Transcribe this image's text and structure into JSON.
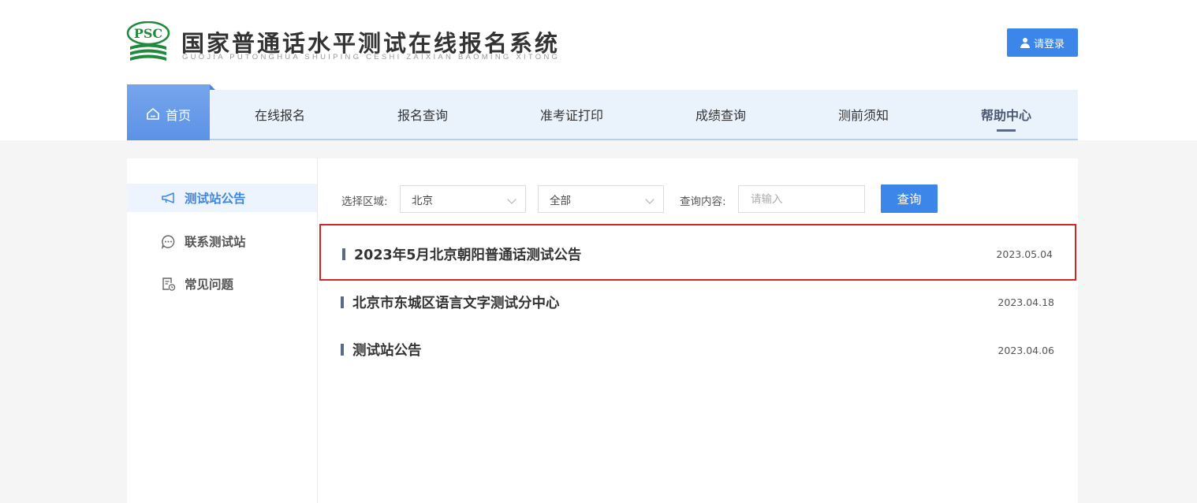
{
  "header": {
    "logo_text": "PSC",
    "title": "国家普通话水平测试在线报名系统",
    "subtitle": "GUOJIA PUTONGHUA SHUIPING CESHI ZAIXIAN BAOMING XITONG",
    "login_label": "请登录",
    "brand_green": "#1f8a3c"
  },
  "nav": {
    "items": [
      {
        "label": "首页"
      },
      {
        "label": "在线报名"
      },
      {
        "label": "报名查询"
      },
      {
        "label": "准考证打印"
      },
      {
        "label": "成绩查询"
      },
      {
        "label": "测前须知"
      },
      {
        "label": "帮助中心"
      }
    ],
    "active": "帮助中心"
  },
  "sidebar": {
    "items": [
      {
        "label": "测试站公告",
        "icon": "megaphone-icon",
        "active": true
      },
      {
        "label": "联系测试站",
        "icon": "chat-bubble-icon",
        "active": false
      },
      {
        "label": "常见问题",
        "icon": "document-clock-icon",
        "active": false
      }
    ]
  },
  "filters": {
    "region_label": "选择区域:",
    "region_value": "北京",
    "district_value": "全部",
    "query_label": "查询内容:",
    "query_placeholder": "请输入",
    "query_button": "查询"
  },
  "announcements": [
    {
      "title": "2023年5月北京朝阳普通话测试公告",
      "date": "2023.05.04",
      "highlighted": true
    },
    {
      "title": "北京市东城区语言文字测试分中心",
      "date": "2023.04.18",
      "highlighted": false
    },
    {
      "title": "测试站公告",
      "date": "2023.04.06",
      "highlighted": false
    }
  ],
  "colors": {
    "accent": "#3b86e8",
    "nav_bg": "#eaf2fc",
    "highlight_border": "#d32525"
  }
}
